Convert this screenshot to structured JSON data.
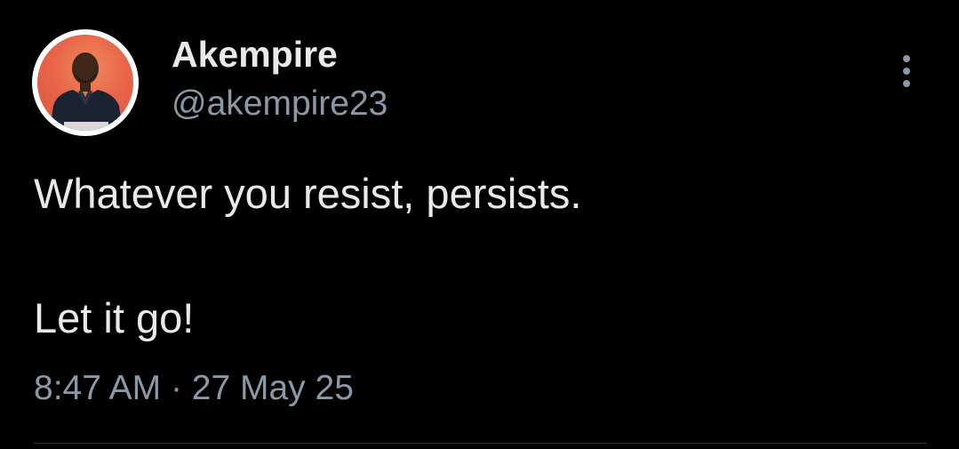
{
  "author": {
    "display_name": "Akempire",
    "handle": "@akempire23",
    "avatar_icon": "profile-photo-avatar"
  },
  "tweet": {
    "lines": [
      "Whatever you resist, persists.",
      "Let it go!"
    ],
    "time": "8:47 AM",
    "separator": "·",
    "date": "27 May 25"
  },
  "actions": {
    "more_icon": "more-vertical-icon"
  },
  "colors": {
    "background": "#000000",
    "primary_text": "#e7e9ea",
    "secondary_text": "#8b98a5",
    "divider": "#2f3336"
  }
}
